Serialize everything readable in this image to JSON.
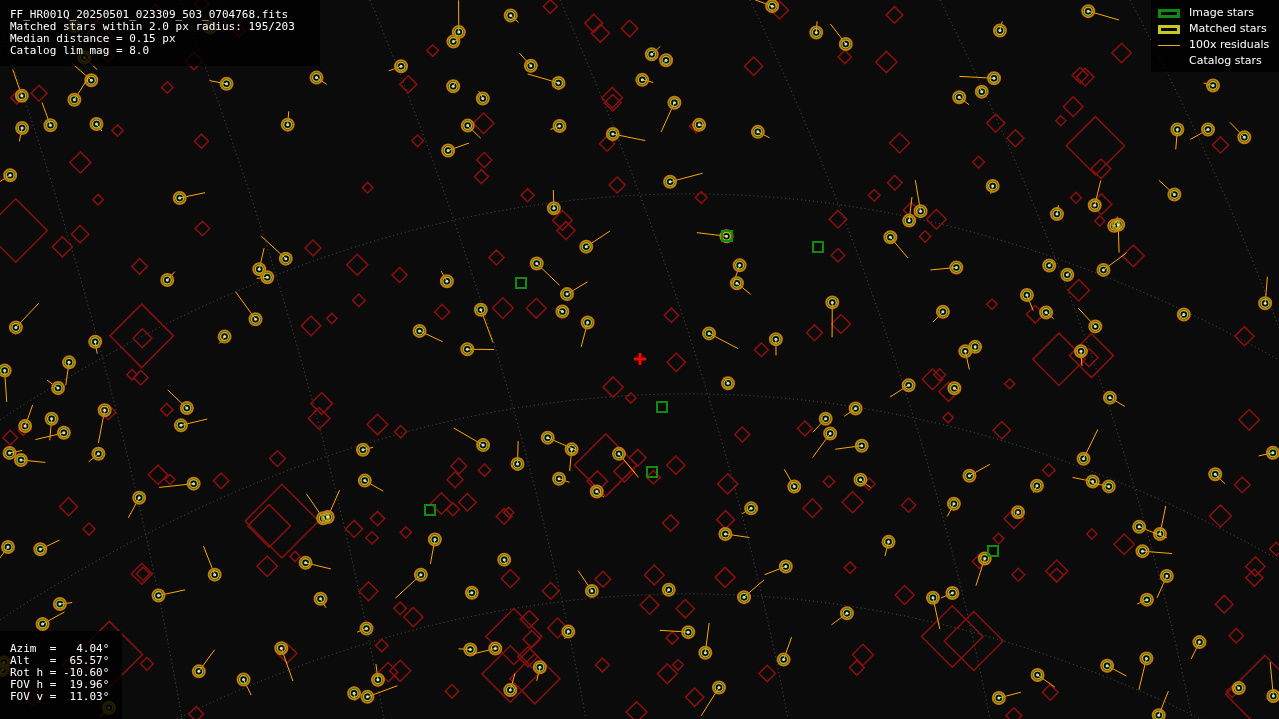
{
  "file_info": {
    "lines": [
      "FF_HR001Q_20250501_023309_503_0704768.fits",
      "Matched stars within 2.0 px radius: 195/203",
      "Median distance = 0.15 px",
      "Catalog lim mag = 8.0"
    ]
  },
  "legend": {
    "items": [
      {
        "label": "Image stars",
        "kind": "box",
        "color": "#108a10"
      },
      {
        "label": "Matched stars",
        "kind": "box",
        "color": "#c8c81e"
      },
      {
        "label": "100x residuals",
        "kind": "line",
        "color": "#ffa500"
      },
      {
        "label": "Catalog stars",
        "kind": "none"
      }
    ]
  },
  "pointing": {
    "lines": [
      "Azim  =   4.04°",
      "Alt   =  65.57°",
      "Rot h = -10.60°",
      "FOV h =  19.96°",
      "FOV v =  11.03°"
    ]
  }
}
